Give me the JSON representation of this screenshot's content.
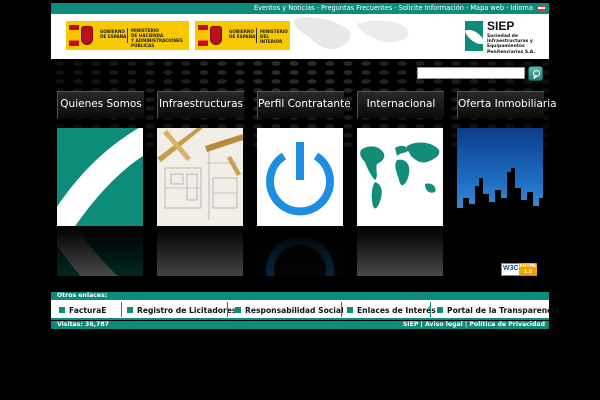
{
  "topbar": {
    "links": [
      "Eventos y Noticias",
      "Preguntas Frecuentes",
      "Solicite Información",
      "Mapa web",
      "Idioma"
    ],
    "separators": [
      "-",
      "-",
      "-",
      "-"
    ]
  },
  "header": {
    "gov_logo_1": {
      "line1": "Gobierno",
      "line2": "de España",
      "ministry": [
        "Ministerio",
        "de Hacienda",
        "y Administraciones Públicas"
      ]
    },
    "gov_logo_2": {
      "line1": "Gobierno",
      "line2": "de España",
      "ministry": [
        "Ministerio",
        "del Interior"
      ]
    },
    "siep": {
      "title": "SIEP",
      "subtitle": "Sociedad de Infraestructuras y Equipamientos Penitenciarios S.A."
    }
  },
  "search": {
    "value": "",
    "placeholder": ""
  },
  "nav": {
    "tabs": [
      {
        "label": "Quienes Somos"
      },
      {
        "label": "Infraestructuras"
      },
      {
        "label": "Perfil Contratante"
      },
      {
        "label": "Internacional"
      },
      {
        "label": "Oferta Inmobiliaria"
      }
    ]
  },
  "badge": {
    "w3c": "W3C",
    "xhtml": "XHTML",
    "version": "1.0"
  },
  "footer": {
    "otros_label": "Otros enlaces:",
    "links": [
      "FacturaE",
      "Registro de Licitadores",
      "Responsabilidad Social",
      "Enlaces de Interés",
      "Portal de la Transparencia"
    ],
    "visits": "Visitas: 36,787",
    "legal": [
      "SIEP",
      "Aviso legal",
      "Política de Privacidad"
    ],
    "legal_sep": "|"
  },
  "colors": {
    "accent": "#0d8c7c",
    "power": "#1e8fe0",
    "map": "#138c7a",
    "background": "#000000"
  }
}
